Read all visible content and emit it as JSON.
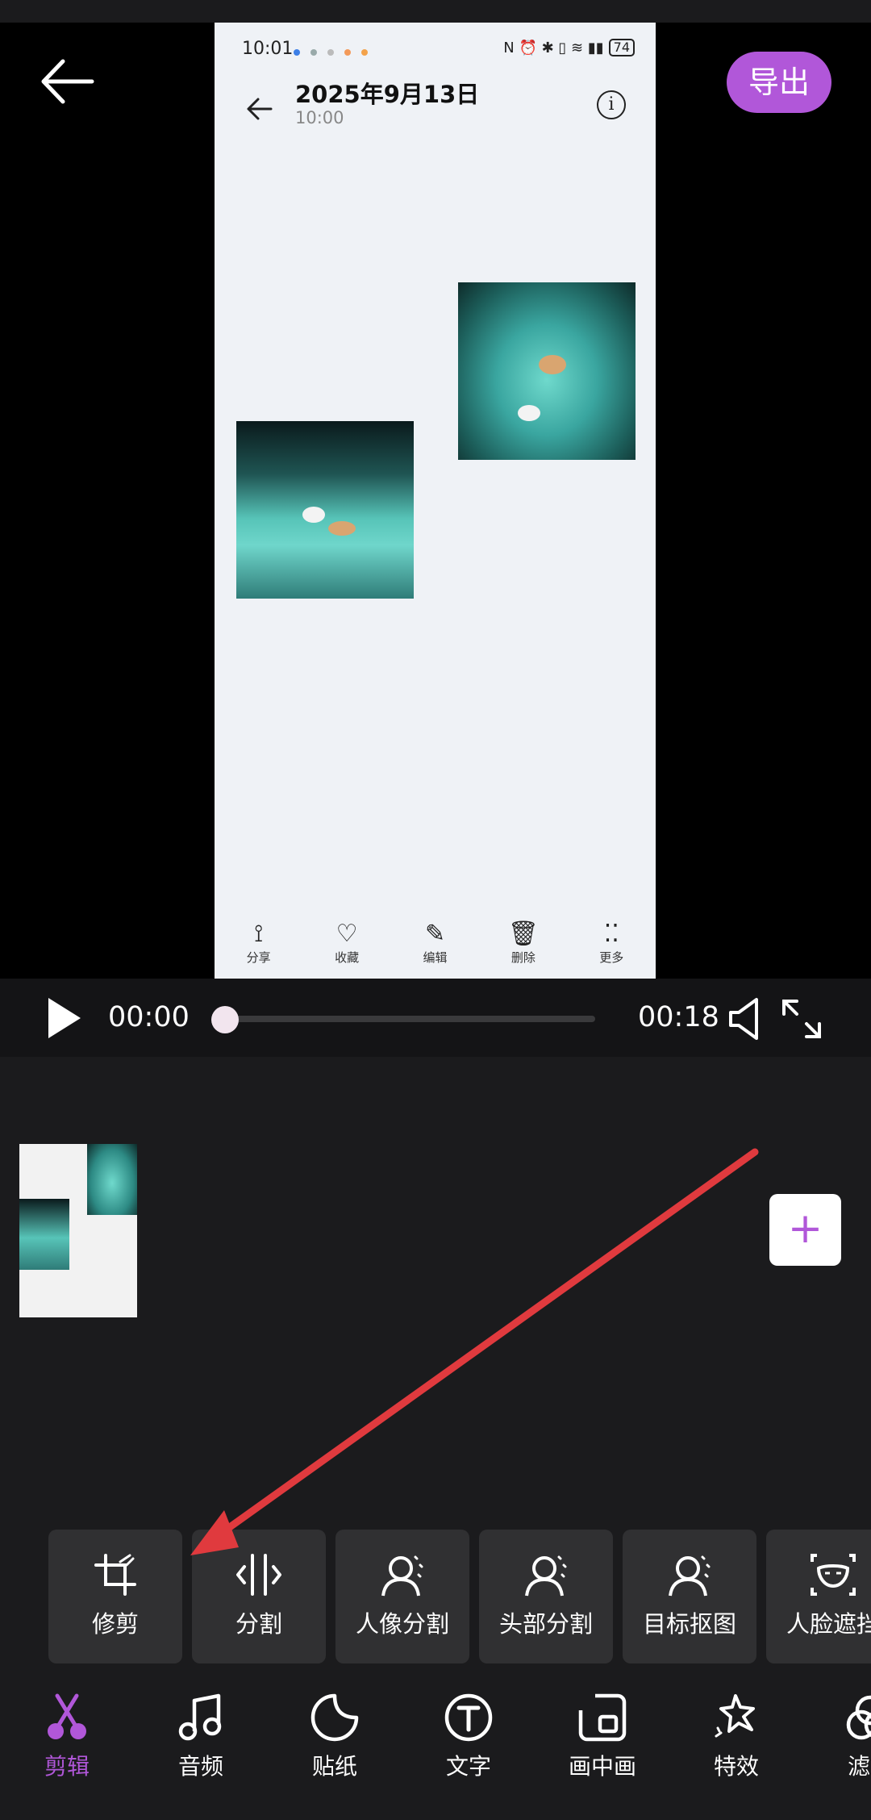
{
  "header": {
    "export_label": "导出"
  },
  "preview": {
    "phone": {
      "status_time": "10:01",
      "status_icons": "N ⏰ ✱ ▯ ≋ ▮▮",
      "battery": "74",
      "title": "2025年9月13日",
      "subtitle": "10:00",
      "toolbar": [
        {
          "icon": "share-icon",
          "label": "分享"
        },
        {
          "icon": "heart-icon",
          "label": "收藏"
        },
        {
          "icon": "edit-icon",
          "label": "编辑"
        },
        {
          "icon": "trash-icon",
          "label": "删除"
        },
        {
          "icon": "more-icon",
          "label": "更多"
        }
      ]
    }
  },
  "player": {
    "current_time": "00:00",
    "end_time": "00:18",
    "progress": 0.0
  },
  "tools": [
    {
      "icon": "crop-icon",
      "label": "修剪"
    },
    {
      "icon": "split-icon",
      "label": "分割"
    },
    {
      "icon": "portrait-segment-icon",
      "label": "人像分割"
    },
    {
      "icon": "head-segment-icon",
      "label": "头部分割"
    },
    {
      "icon": "object-cutout-icon",
      "label": "目标抠图"
    },
    {
      "icon": "face-mask-icon",
      "label": "人脸遮挡"
    }
  ],
  "nav": [
    {
      "icon": "scissors-icon",
      "label": "剪辑",
      "active": true
    },
    {
      "icon": "music-icon",
      "label": "音频"
    },
    {
      "icon": "sticker-icon",
      "label": "贴纸"
    },
    {
      "icon": "text-icon",
      "label": "文字"
    },
    {
      "icon": "pip-icon",
      "label": "画中画"
    },
    {
      "icon": "effects-icon",
      "label": "特效"
    },
    {
      "icon": "filter-icon",
      "label": "滤镜"
    }
  ],
  "colors": {
    "accent": "#b157d9",
    "annotation_arrow": "#e03a3e"
  }
}
